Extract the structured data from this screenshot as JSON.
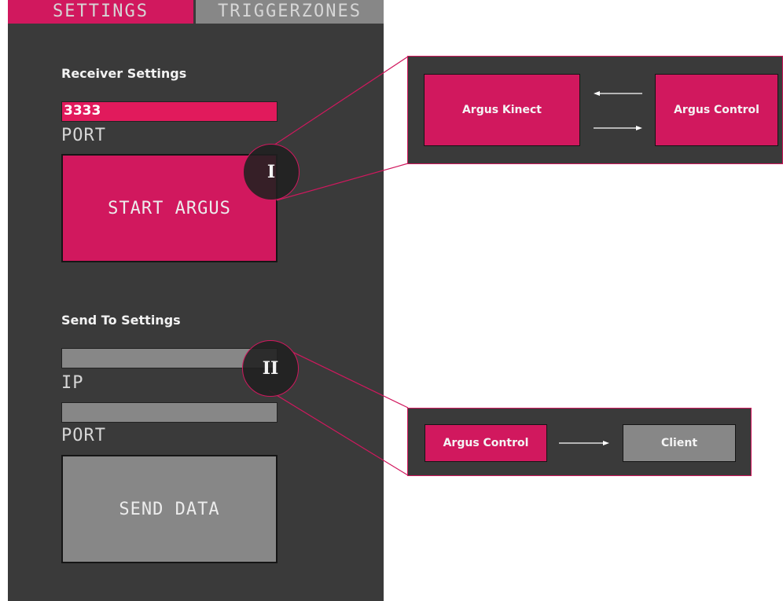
{
  "tabs": {
    "settings_label": "SETTINGS",
    "triggerzones_label": "TRIGGERZONES"
  },
  "receiver": {
    "title": "Receiver Settings",
    "port_value": "3333",
    "port_label": "PORT",
    "start_button_label": "START ARGUS"
  },
  "send_to": {
    "title": "Send To Settings",
    "ip_value": "",
    "ip_label": "IP",
    "port_value": "",
    "port_label": "PORT",
    "send_button_label": "SEND DATA"
  },
  "callouts": {
    "one": {
      "marker": "I",
      "left_node": "Argus Kinect",
      "right_node": "Argus Control"
    },
    "two": {
      "marker": "II",
      "left_node": "Argus Control",
      "right_node": "Client"
    }
  },
  "colors": {
    "accent": "#d1185e",
    "field_accent": "#e11a5c",
    "panel_bg": "#3a3a3a",
    "inactive": "#878787"
  }
}
